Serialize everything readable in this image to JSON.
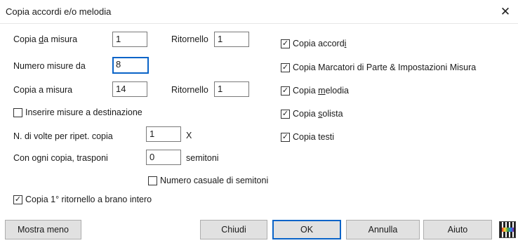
{
  "window": {
    "title": "Copia accordi e/o melodia",
    "close_glyph": "✕"
  },
  "left": {
    "copy_from": {
      "label_pre": "Copia ",
      "label_u": "d",
      "label_post": "a misura",
      "value": "1"
    },
    "repeat_from": {
      "label": "Ritornello",
      "value": "1"
    },
    "num_bars": {
      "label": "Numero misure da",
      "value": "8"
    },
    "copy_to": {
      "label": "Copia a misura",
      "value": "14"
    },
    "repeat_to": {
      "label": "Ritornello",
      "value": "1"
    },
    "insert_bars": {
      "label": "Inserire misure a destinazione",
      "checked": false
    },
    "times": {
      "label": "N. di volte per ripet. copia",
      "value": "1",
      "suffix": "X"
    },
    "transpose": {
      "label": "Con ogni copia, trasponi",
      "value": "0",
      "suffix": "semitoni"
    },
    "random_semitones": {
      "label": "Numero casuale di semitoni",
      "checked": false
    },
    "copy_first_ending": {
      "label": "Copia 1° ritornello a brano intero",
      "checked": true
    }
  },
  "right": {
    "copy_chords": {
      "label_pre": "Copia accord",
      "label_u": "i",
      "label_post": "",
      "checked": true
    },
    "copy_markers": {
      "label": "Copia Marcatori di Parte & Impostazioni Misura",
      "checked": true
    },
    "copy_melody": {
      "label_pre": "Copia ",
      "label_u": "m",
      "label_post": "elodia",
      "checked": true
    },
    "copy_soloist": {
      "label_pre": "Copia ",
      "label_u": "s",
      "label_post": "olista",
      "checked": true
    },
    "copy_lyrics": {
      "label": "Copia testi",
      "checked": true
    }
  },
  "buttons": {
    "show_less": "Mostra meno",
    "close": "Chiudi",
    "ok": "OK",
    "cancel": "Annulla",
    "help": "Aiuto"
  },
  "icons": {
    "check": "✓",
    "app": "band-in-a-box-icon"
  },
  "colors": {
    "focus": "#0a64c8",
    "button_face": "#e1e1e1"
  }
}
